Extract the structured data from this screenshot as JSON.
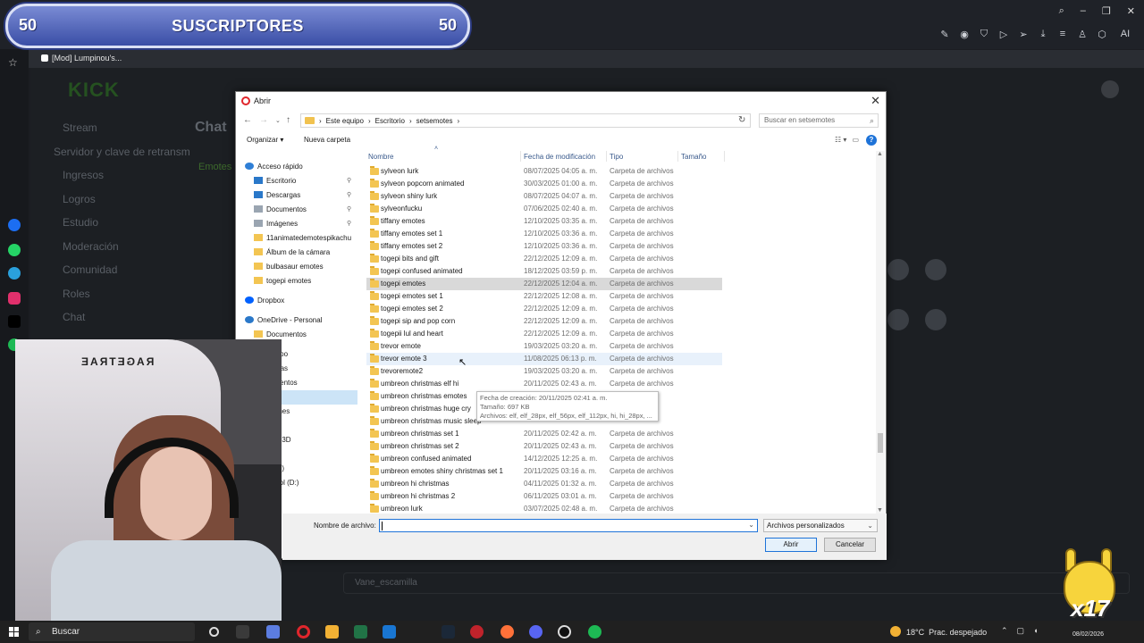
{
  "banner": {
    "left_num": "50",
    "title": "SUSCRIPTORES",
    "right_num": "50"
  },
  "browser": {
    "tab_title": "[Mod] Lumpinou's...",
    "toolbar_icons": [
      "edit-icon",
      "camera-icon",
      "shield-icon",
      "play-icon",
      "send-icon",
      "download-icon",
      "menu-icon",
      "user-icon",
      "cube-icon",
      "ai-icon"
    ],
    "ai_label": "AI"
  },
  "kick": {
    "logo": "KICK",
    "nav": [
      "Stream",
      "Servidor y clave de retransm",
      "Ingresos",
      "Logros",
      "Estudio",
      "Moderación",
      "Comunidad",
      "Roles",
      "Chat"
    ],
    "chat_title": "Chat",
    "emotes_tab": "Emotes",
    "chat_input": "Vane_escamilla"
  },
  "dialog": {
    "title": "Abrir",
    "breadcrumb": [
      "Este equipo",
      "Escritorio",
      "setsemotes"
    ],
    "search_placeholder": "Buscar en setsemotes",
    "organize": "Organizar",
    "new_folder": "Nueva carpeta",
    "columns": {
      "name": "Nombre",
      "date": "Fecha de modificación",
      "type": "Tipo",
      "size": "Tamaño"
    },
    "nav": [
      {
        "label": "Acceso rápido",
        "kind": "star",
        "pinned": false
      },
      {
        "label": "Escritorio",
        "kind": "blue",
        "pinned": true
      },
      {
        "label": "Descargas",
        "kind": "blue",
        "pinned": true
      },
      {
        "label": "Documentos",
        "kind": "doc",
        "pinned": true
      },
      {
        "label": "Imágenes",
        "kind": "img",
        "pinned": true
      },
      {
        "label": "11animatedemotespikachu",
        "kind": "folder",
        "pinned": false
      },
      {
        "label": "Álbum de la cámara",
        "kind": "folder",
        "pinned": false
      },
      {
        "label": "bulbasaur emotes",
        "kind": "folder",
        "pinned": false
      },
      {
        "label": "togepi emotes",
        "kind": "folder",
        "pinned": false
      },
      {
        "label": "Dropbox",
        "kind": "dropbox",
        "pinned": false
      },
      {
        "label": "OneDrive - Personal",
        "kind": "cloud",
        "pinned": false
      },
      {
        "label": "Documentos",
        "kind": "folder",
        "pinned": false
      },
      {
        "label": "equipo",
        "kind": "none",
        "pinned": false
      },
      {
        "label": "cargas",
        "kind": "none",
        "pinned": false
      },
      {
        "label": "cumentos",
        "kind": "none",
        "pinned": false
      },
      {
        "label": "itorio",
        "kind": "sel",
        "pinned": false
      },
      {
        "label": "ágenes",
        "kind": "none",
        "pinned": false
      },
      {
        "label": "ica",
        "kind": "none",
        "pinned": false
      },
      {
        "label": "etos 3D",
        "kind": "none",
        "pinned": false
      },
      {
        "label": "os",
        "kind": "none",
        "pinned": false
      },
      {
        "label": "d (C:)",
        "kind": "none",
        "pinned": false
      },
      {
        "label": "vo vol (D:)",
        "kind": "none",
        "pinned": false
      }
    ],
    "files": [
      {
        "name": "sylveon lurk",
        "date": "08/07/2025 04:05 a. m.",
        "type": "Carpeta de archivos"
      },
      {
        "name": "sylveon popcorn animated",
        "date": "30/03/2025 01:00 a. m.",
        "type": "Carpeta de archivos"
      },
      {
        "name": "sylveon shiny lurk",
        "date": "08/07/2025 04:07 a. m.",
        "type": "Carpeta de archivos"
      },
      {
        "name": "sylveonfucku",
        "date": "07/06/2025 02:40 a. m.",
        "type": "Carpeta de archivos"
      },
      {
        "name": "tiffany emotes",
        "date": "12/10/2025 03:35 a. m.",
        "type": "Carpeta de archivos"
      },
      {
        "name": "tiffany emotes set 1",
        "date": "12/10/2025 03:36 a. m.",
        "type": "Carpeta de archivos"
      },
      {
        "name": "tiffany emotes set 2",
        "date": "12/10/2025 03:36 a. m.",
        "type": "Carpeta de archivos"
      },
      {
        "name": "togepi bits and gift",
        "date": "22/12/2025 12:09 a. m.",
        "type": "Carpeta de archivos"
      },
      {
        "name": "togepi confused animated",
        "date": "18/12/2025 03:59 p. m.",
        "type": "Carpeta de archivos"
      },
      {
        "name": "togepi emotes",
        "date": "22/12/2025 12:04 a. m.",
        "type": "Carpeta de archivos"
      },
      {
        "name": "togepi emotes set 1",
        "date": "22/12/2025 12:08 a. m.",
        "type": "Carpeta de archivos"
      },
      {
        "name": "togepi emotes set 2",
        "date": "22/12/2025 12:09 a. m.",
        "type": "Carpeta de archivos"
      },
      {
        "name": "togepi sip and pop corn",
        "date": "22/12/2025 12:09 a. m.",
        "type": "Carpeta de archivos"
      },
      {
        "name": "togepii lul and heart",
        "date": "22/12/2025 12:09 a. m.",
        "type": "Carpeta de archivos"
      },
      {
        "name": "trevor emote",
        "date": "19/03/2025 03:20 a. m.",
        "type": "Carpeta de archivos"
      },
      {
        "name": "trevor emote 3",
        "date": "11/08/2025 06:13 p. m.",
        "type": "Carpeta de archivos"
      },
      {
        "name": "trevoremote2",
        "date": "19/03/2025 03:20 a. m.",
        "type": "Carpeta de archivos"
      },
      {
        "name": "umbreon christmas elf hi",
        "date": "20/11/2025 02:43 a. m.",
        "type": "Carpeta de archivos"
      },
      {
        "name": "umbreon christmas emotes",
        "date": "",
        "type": ""
      },
      {
        "name": "umbreon christmas huge cry",
        "date": "",
        "type": ""
      },
      {
        "name": "umbreon christmas music sleep",
        "date": "",
        "type": ""
      },
      {
        "name": "umbreon christmas set 1",
        "date": "20/11/2025 02:42 a. m.",
        "type": "Carpeta de archivos"
      },
      {
        "name": "umbreon christmas set 2",
        "date": "20/11/2025 02:43 a. m.",
        "type": "Carpeta de archivos"
      },
      {
        "name": "umbreon confused animated",
        "date": "14/12/2025 12:25 a. m.",
        "type": "Carpeta de archivos"
      },
      {
        "name": "umbreon emotes shiny christmas set 1",
        "date": "20/11/2025 03:16 a. m.",
        "type": "Carpeta de archivos"
      },
      {
        "name": "umbreon hi christmas",
        "date": "04/11/2025 01:32 a. m.",
        "type": "Carpeta de archivos"
      },
      {
        "name": "umbreon hi christmas 2",
        "date": "06/11/2025 03:01 a. m.",
        "type": "Carpeta de archivos"
      },
      {
        "name": "umbreon lurk",
        "date": "03/07/2025 02:48 a. m.",
        "type": "Carpeta de archivos"
      }
    ],
    "selected_index": 9,
    "hover_index": 15,
    "tooltip": {
      "line1": "Fecha de creación: 20/11/2025 02:41 a. m.",
      "line2": "Tamaño: 697 KB",
      "line3": "Archivos: elf, elf_28px, elf_56px, elf_112px, hi, hi_28px, ..."
    },
    "filename_label": "Nombre de archivo:",
    "filename_value": "",
    "filetype": "Archivos personalizados",
    "open": "Abrir",
    "cancel": "Cancelar"
  },
  "taskbar": {
    "search": "Buscar",
    "temp": "18°C",
    "weather": "Prac. despejado",
    "date": "08/02/2026"
  },
  "overlay": {
    "pikachu_text": "x17"
  }
}
